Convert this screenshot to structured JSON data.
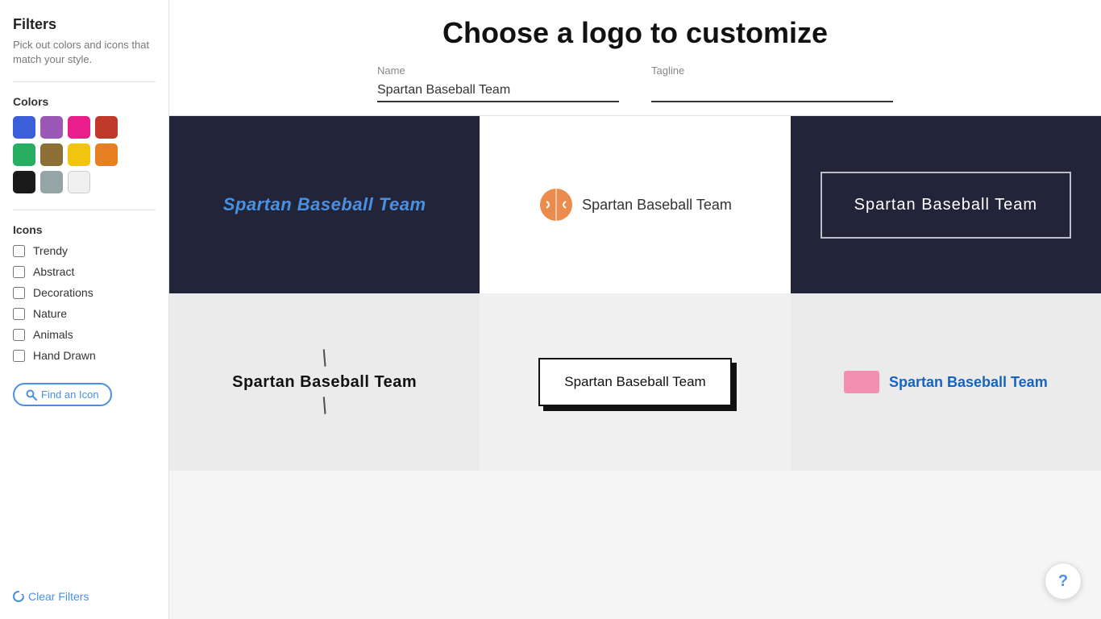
{
  "sidebar": {
    "title": "Filters",
    "subtitle": "Pick out colors and icons that match your style.",
    "colors_label": "Colors",
    "colors": [
      {
        "name": "blue",
        "hex": "#3a5fd9"
      },
      {
        "name": "purple",
        "hex": "#9b59b6"
      },
      {
        "name": "pink",
        "hex": "#e91e8c"
      },
      {
        "name": "red",
        "hex": "#c0392b"
      },
      {
        "name": "green",
        "hex": "#27ae60"
      },
      {
        "name": "brown",
        "hex": "#8d6e35"
      },
      {
        "name": "yellow",
        "hex": "#f1c40f"
      },
      {
        "name": "orange",
        "hex": "#e67e22"
      },
      {
        "name": "black",
        "hex": "#1a1a1a"
      },
      {
        "name": "gray",
        "hex": "#95a5a6"
      },
      {
        "name": "white",
        "hex": "#f0f0f0"
      }
    ],
    "icons_label": "Icons",
    "icon_options": [
      {
        "label": "Trendy",
        "checked": false
      },
      {
        "label": "Abstract",
        "checked": false
      },
      {
        "label": "Decorations",
        "checked": false
      },
      {
        "label": "Nature",
        "checked": false
      },
      {
        "label": "Animals",
        "checked": false
      },
      {
        "label": "Hand Drawn",
        "checked": false
      }
    ],
    "find_icon_label": "Find an Icon",
    "clear_filters_label": "Clear Filters"
  },
  "main": {
    "title": "Choose a logo to customize",
    "name_label": "Name",
    "tagline_label": "Tagline",
    "name_value": "Spartan Baseball Team",
    "tagline_value": "",
    "logos": [
      {
        "id": 1,
        "bg": "dark",
        "style": "text-center-blue",
        "text": "Spartan Baseball Team"
      },
      {
        "id": 2,
        "bg": "white",
        "style": "icon-left",
        "text": "Spartan Baseball Team"
      },
      {
        "id": 3,
        "bg": "dark",
        "style": "bordered-inner",
        "text": "Spartan Baseball Team"
      },
      {
        "id": 4,
        "bg": "light-gray",
        "style": "slash-serif",
        "text": "Spartan Baseball Team"
      },
      {
        "id": 5,
        "bg": "gray",
        "style": "black-box-shadow",
        "text": "Spartan Baseball Team"
      },
      {
        "id": 6,
        "bg": "light-gray",
        "style": "pink-rect-blue-text",
        "text": "Spartan Baseball Team"
      }
    ]
  },
  "help": {
    "label": "?"
  }
}
